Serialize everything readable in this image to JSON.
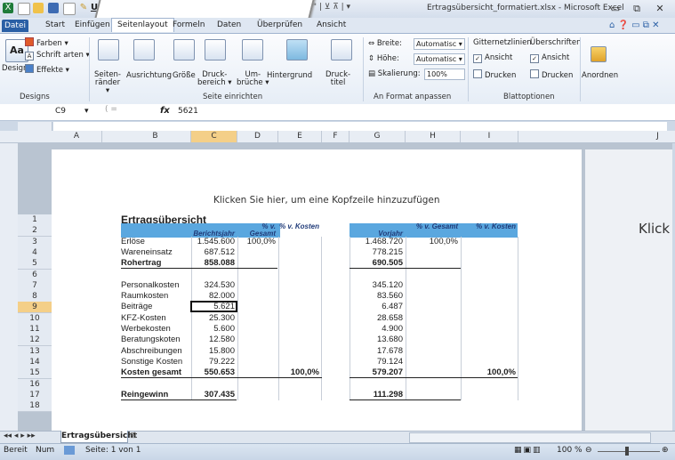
{
  "window": {
    "title": "Ertragsübersicht_formatiert.xlsx - Microsoft Excel",
    "min": "▭",
    "restore": "⧉",
    "close": "☒"
  },
  "ribbon_tabs": [
    "Start",
    "Einfügen",
    "Seitenlayout",
    "Formeln",
    "Daten",
    "Überprüfen",
    "Ansicht"
  ],
  "file_tab": "Datei",
  "active_tab": "Seitenlayout",
  "ribbon": {
    "designs": {
      "farben": "Farben ▾",
      "schriftarten": "Schrift arten ▾",
      "effekte": "Effekte ▾",
      "designs_btn": "Designs",
      "label": "Designs"
    },
    "seite": {
      "seitenraender": "Seiten-\nränder ▾",
      "ausrichtung": "Ausrichtung",
      "groesse": "Größe",
      "druckbereich": "Druck-\nbereich ▾",
      "umbrueche": "Um-\nbrüche ▾",
      "hintergrund": "Hintergrund",
      "drucktitel": "Druck-\ntitel",
      "label": "Seite einrichten"
    },
    "anformat": {
      "breite": "Breite:",
      "breite_val": "Automatisc ▾",
      "hoehe": "Höhe:",
      "hoehe_val": "Automatisc ▾",
      "skalierung": "Skalierung:",
      "skalierung_val": "100%",
      "label": "An Format anpassen"
    },
    "blatt": {
      "gitternetzlinien": "Gitternetzlinien",
      "ueberschriften": "Überschriften",
      "ansicht1": "Ansicht",
      "ansicht2": "Ansicht",
      "drucken1": "Drucken",
      "drucken2": "Drucken",
      "label": "Blattoptionen"
    },
    "anordnen": "Anordnen"
  },
  "formula_bar": {
    "name_box": "C9",
    "fx": "fx",
    "value": "5621"
  },
  "columns": [
    "A",
    "B",
    "C",
    "D",
    "E",
    "F",
    "G",
    "H",
    "I",
    "J"
  ],
  "selected_column": "C",
  "selected_row": "9",
  "rows": [
    "1",
    "2",
    "3",
    "4",
    "5",
    "6",
    "7",
    "8",
    "9",
    "10",
    "11",
    "12",
    "13",
    "14",
    "15",
    "16",
    "17",
    "18"
  ],
  "header_prompt": "Klicken Sie hier, um eine Kopfzeile hinzuzufügen",
  "page2_prompt": "Klick",
  "sheet": {
    "title": "Ertragsübersicht",
    "hdr_berichtsjahr": "Berichtsjahr",
    "hdr_pct_gesamt": "% v. Gesamt",
    "hdr_pct_kosten": "% v. Kosten",
    "hdr_vorjahr": "Vorjahr",
    "hdr_pct_gesamt2": "% v. Gesamt",
    "hdr_pct_kosten2": "% v. Kosten",
    "lines": [
      {
        "label": "Erlöse",
        "bj": "1.545.600",
        "pg": "100,0%",
        "pk": "",
        "vj": "1.468.720",
        "pg2": "100,0%",
        "pk2": "",
        "bold": false
      },
      {
        "label": "Wareneinsatz",
        "bj": "687.512",
        "pg": "",
        "pk": "",
        "vj": "778.215",
        "pg2": "",
        "pk2": "",
        "bold": false
      },
      {
        "label": "Rohertrag",
        "bj": "858.088",
        "pg": "",
        "pk": "",
        "vj": "690.505",
        "pg2": "",
        "pk2": "",
        "bold": true
      },
      {
        "label": "",
        "bj": "",
        "pg": "",
        "pk": "",
        "vj": "",
        "pg2": "",
        "pk2": "",
        "bold": false
      },
      {
        "label": "Personalkosten",
        "bj": "324.530",
        "pg": "",
        "pk": "",
        "vj": "345.120",
        "pg2": "",
        "pk2": "",
        "bold": false
      },
      {
        "label": "Raumkosten",
        "bj": "82.000",
        "pg": "",
        "pk": "",
        "vj": "83.560",
        "pg2": "",
        "pk2": "",
        "bold": false
      },
      {
        "label": "Beiträge",
        "bj": "5.621",
        "pg": "",
        "pk": "",
        "vj": "6.487",
        "pg2": "",
        "pk2": "",
        "bold": false
      },
      {
        "label": "KFZ-Kosten",
        "bj": "25.300",
        "pg": "",
        "pk": "",
        "vj": "28.658",
        "pg2": "",
        "pk2": "",
        "bold": false
      },
      {
        "label": "Werbekosten",
        "bj": "5.600",
        "pg": "",
        "pk": "",
        "vj": "4.900",
        "pg2": "",
        "pk2": "",
        "bold": false
      },
      {
        "label": "Beratungskoten",
        "bj": "12.580",
        "pg": "",
        "pk": "",
        "vj": "13.680",
        "pg2": "",
        "pk2": "",
        "bold": false
      },
      {
        "label": "Abschreibungen",
        "bj": "15.800",
        "pg": "",
        "pk": "",
        "vj": "17.678",
        "pg2": "",
        "pk2": "",
        "bold": false
      },
      {
        "label": "Sonstige Kosten",
        "bj": "79.222",
        "pg": "",
        "pk": "",
        "vj": "79.124",
        "pg2": "",
        "pk2": "",
        "bold": false
      },
      {
        "label": "Kosten gesamt",
        "bj": "550.653",
        "pg": "",
        "pk": "100,0%",
        "vj": "579.207",
        "pg2": "",
        "pk2": "100,0%",
        "bold": true
      },
      {
        "label": "",
        "bj": "",
        "pg": "",
        "pk": "",
        "vj": "",
        "pg2": "",
        "pk2": "",
        "bold": false
      },
      {
        "label": "Reingewinn",
        "bj": "307.435",
        "pg": "",
        "pk": "",
        "vj": "111.298",
        "pg2": "",
        "pk2": "",
        "bold": true
      }
    ]
  },
  "sheet_tab": "Ertragsübersicht",
  "status": {
    "bereit": "Bereit",
    "num": "Num",
    "seite": "Seite: 1 von 1",
    "zoom": "100 %"
  },
  "colors": {
    "header_band": "#5aa7df",
    "file_tab": "#2a5fa5",
    "selection": "#f4cf88"
  }
}
